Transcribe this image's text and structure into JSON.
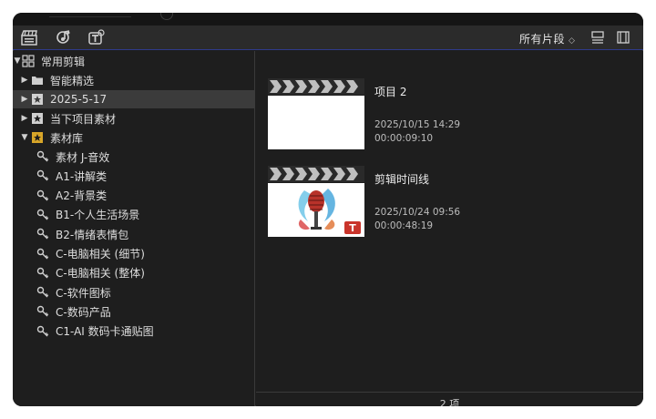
{
  "toolbar": {
    "icons": [
      "clapper-board-icon",
      "music-note-icon",
      "title-text-icon"
    ],
    "filter_label": "所有片段",
    "filter_caret": "◇",
    "right_icons": [
      "list-view-icon",
      "filmstrip-view-icon"
    ]
  },
  "sidebar": {
    "root": {
      "label": "常用剪辑",
      "icon": "library-grid-icon"
    },
    "items": [
      {
        "label": "智能精选",
        "icon": "folder-icon"
      },
      {
        "label": "2025-5-17",
        "icon": "event-star-icon",
        "selected": true
      },
      {
        "label": "当下项目素材",
        "icon": "event-star-icon"
      },
      {
        "label": "素材库",
        "icon": "event-star-icon",
        "expanded": true
      }
    ],
    "keywords": [
      "素材 J-音效",
      "A1-讲解类",
      "A2-背景类",
      "B1-个人生活场景",
      "B2-情绪表情包",
      "C-电脑相关 (细节)",
      "C-电脑相关 (整体)",
      "C-软件图标",
      "C-数码产品",
      "C1-AI 数码卡通贴图"
    ]
  },
  "content": {
    "items": [
      {
        "name": "项目 2",
        "date": "2025/10/15 14:29",
        "duration": "00:00:09:10",
        "thumb": "blank"
      },
      {
        "name": "剪辑时间线",
        "date": "2025/10/24 09:56",
        "duration": "00:00:48:19",
        "thumb": "microphone"
      }
    ],
    "count_label": "2 项"
  },
  "colors": {
    "window_bg": "#1e1e1e",
    "toolbar_bg": "#2b2b2b",
    "selection_bg": "#3b3b3b",
    "accent_line": "#2f3b8c",
    "event_star": "#d8a629",
    "badge_red": "#c9342b"
  }
}
